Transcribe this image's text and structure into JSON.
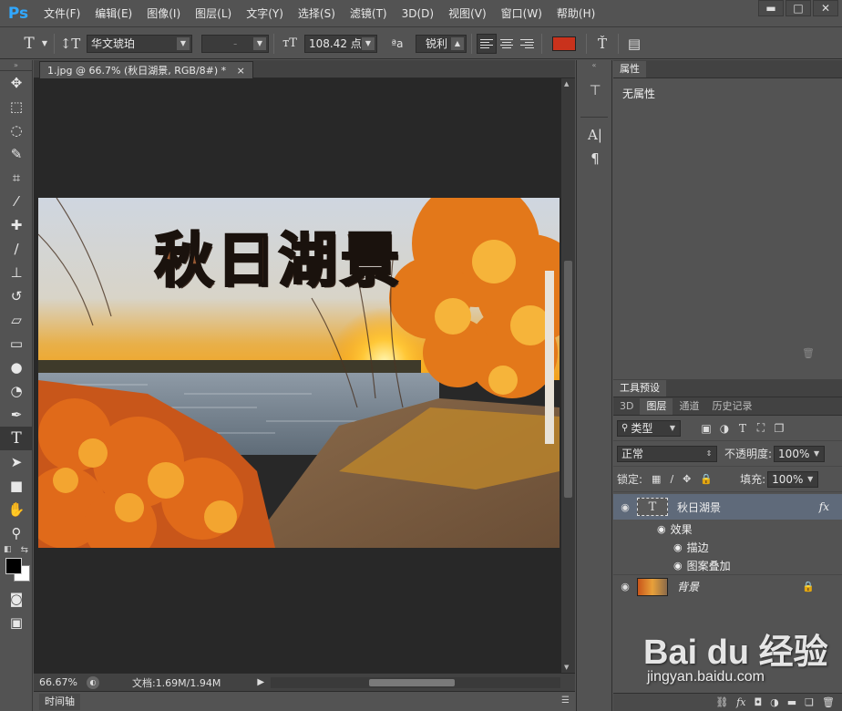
{
  "app": {
    "logo": "Ps"
  },
  "menu": [
    "文件(F)",
    "编辑(E)",
    "图像(I)",
    "图层(L)",
    "文字(Y)",
    "选择(S)",
    "滤镜(T)",
    "3D(D)",
    "视图(V)",
    "窗口(W)",
    "帮助(H)"
  ],
  "window_controls": {
    "minimize": "▬",
    "maximize": "□",
    "close": "✕"
  },
  "options": {
    "font_family": "华文琥珀",
    "font_style": "-",
    "font_size": "108.42 点",
    "antialias_icon_text": "ªa",
    "antialias": "锐利",
    "text_color": "#c9321c"
  },
  "document": {
    "tab_title": "1.jpg @ 66.7% (秋日湖景, RGB/8#) *",
    "tab_close": "×",
    "image_text": "秋日湖景",
    "zoom": "66.67%",
    "doc_info": "文档:1.69M/1.94M"
  },
  "timeline": {
    "label": "时间轴"
  },
  "properties": {
    "tab": "属性",
    "empty_text": "无属性"
  },
  "tool_presets": {
    "tab": "工具预设"
  },
  "layers_panel": {
    "tabs": [
      "3D",
      "图层",
      "通道",
      "历史记录"
    ],
    "filter_kind": "类型",
    "blend_mode": "正常",
    "opacity_label": "不透明度:",
    "opacity_value": "100%",
    "lock_label": "锁定:",
    "fill_label": "填充:",
    "fill_value": "100%",
    "layers": [
      {
        "name": "秋日湖景",
        "type": "text",
        "fx": "fx"
      },
      {
        "name": "效果"
      },
      {
        "name": "描边"
      },
      {
        "name": "图案叠加"
      },
      {
        "name": "背景",
        "type": "image"
      }
    ]
  },
  "watermark": {
    "logo": "Bai du 经验",
    "url": "jingyan.baidu.com"
  }
}
